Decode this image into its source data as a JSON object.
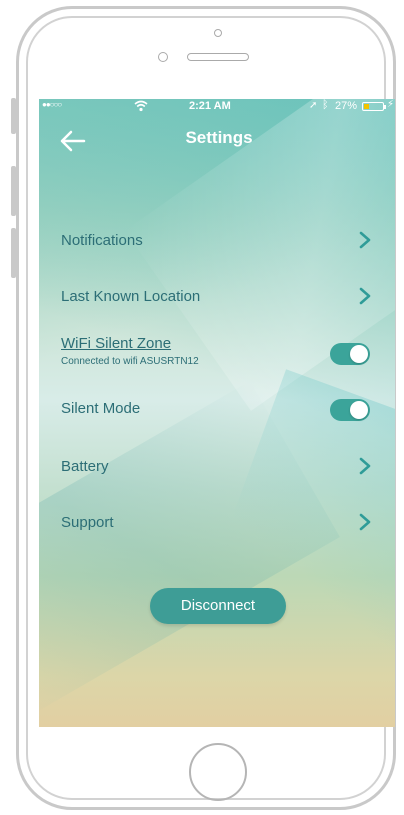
{
  "status_bar": {
    "signal": "●●○○○",
    "time": "2:21 AM",
    "battery_percent": "27%",
    "battery_level": 0.27,
    "battery_color": "#f2c300"
  },
  "header": {
    "title": "Settings",
    "back_icon": "arrow-left-icon"
  },
  "settings": {
    "notifications": {
      "label": "Notifications",
      "icon": "chevron-right-icon"
    },
    "last_known_location": {
      "label": "Last Known Location",
      "icon": "chevron-right-icon"
    },
    "wifi_silent_zone": {
      "label": "WiFi Silent Zone",
      "sublabel": "Connected to wifi ASUSRTN12",
      "enabled": true
    },
    "silent_mode": {
      "label": "Silent Mode",
      "enabled": true
    },
    "battery": {
      "label": "Battery",
      "icon": "chevron-right-icon"
    },
    "support": {
      "label": "Support",
      "icon": "chevron-right-icon"
    }
  },
  "disconnect_button": {
    "label": "Disconnect"
  },
  "colors": {
    "accent": "#3ba49a",
    "text": "#2c6e76"
  }
}
